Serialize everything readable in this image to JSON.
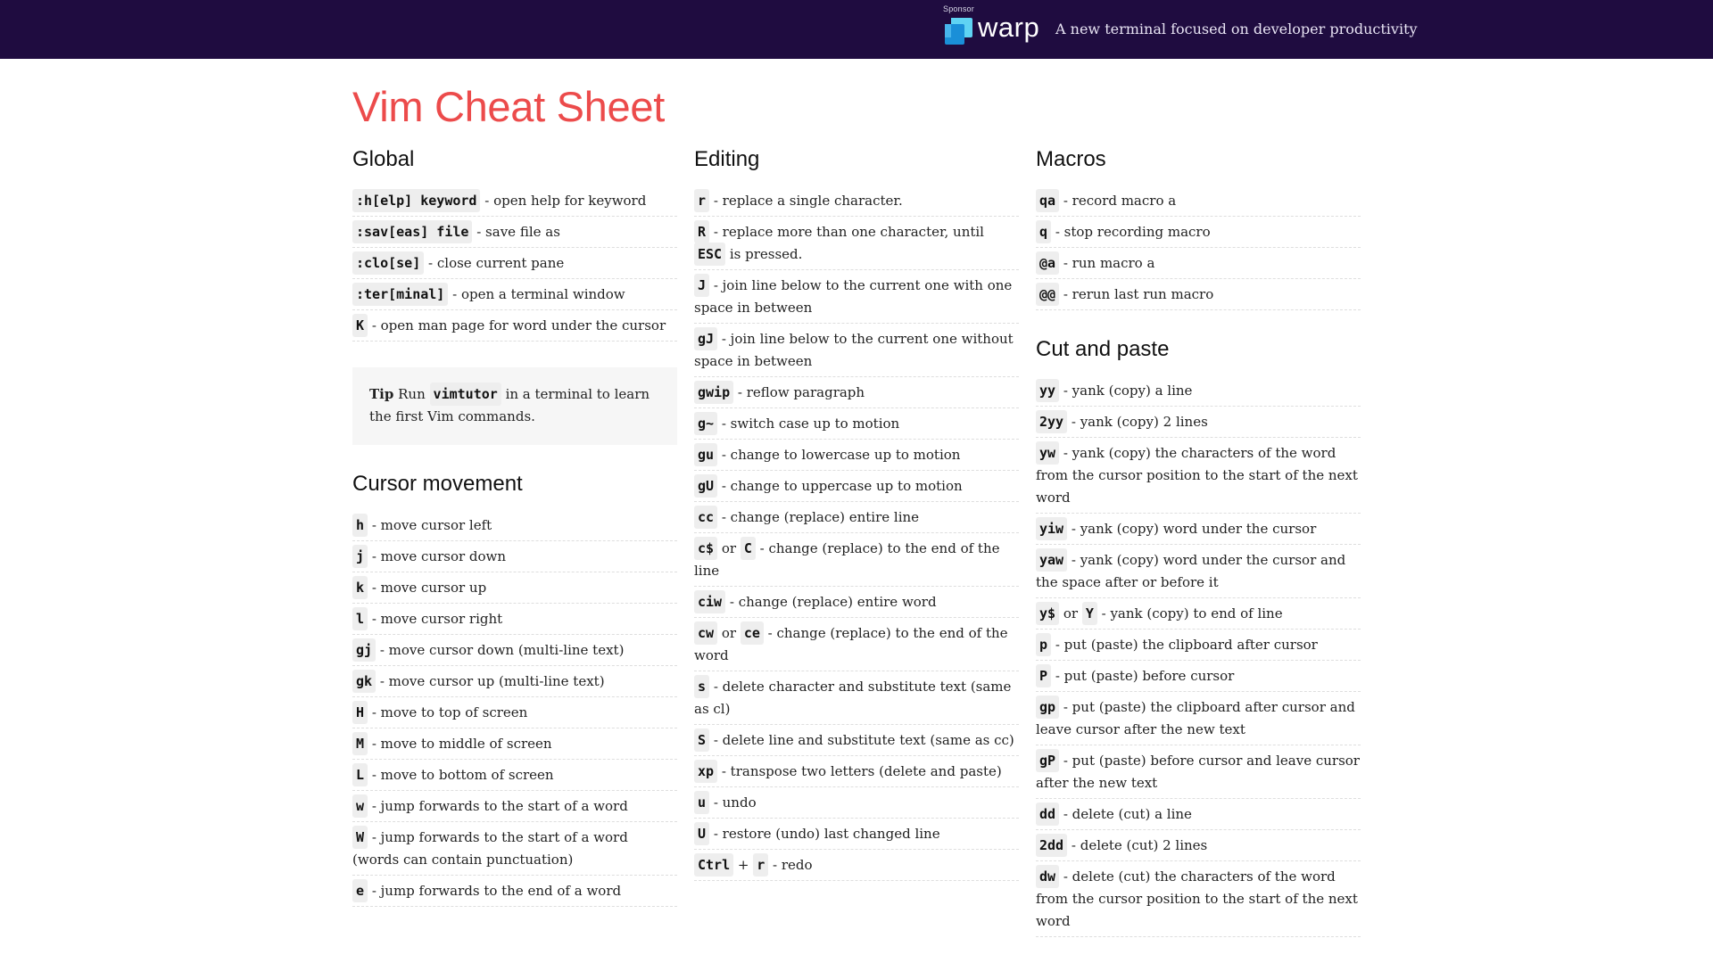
{
  "sponsor": {
    "label": "Sponsor",
    "name": "warp",
    "tagline": "A new terminal focused on developer productivity",
    "bar_color": "#1f0c40",
    "logo_colors": [
      "#5fd3f3",
      "#1a8fd8"
    ]
  },
  "title": "Vim Cheat Sheet",
  "title_color": "#ec4b4b",
  "columns": [
    {
      "sections": [
        {
          "title": "Global",
          "items": [
            {
              "keys": [
                ":h[elp] keyword"
              ],
              "desc": "- open help for keyword"
            },
            {
              "keys": [
                ":sav[eas] file"
              ],
              "desc": "- save file as"
            },
            {
              "keys": [
                ":clo[se]"
              ],
              "desc": "- close current pane"
            },
            {
              "keys": [
                ":ter[minal]"
              ],
              "desc": "- open a terminal window"
            },
            {
              "keys": [
                "K"
              ],
              "desc": "- open man page for word under the cursor"
            }
          ]
        },
        {
          "title": "Cursor movement",
          "items": [
            {
              "keys": [
                "h"
              ],
              "desc": "- move cursor left"
            },
            {
              "keys": [
                "j"
              ],
              "desc": "- move cursor down"
            },
            {
              "keys": [
                "k"
              ],
              "desc": "- move cursor up"
            },
            {
              "keys": [
                "l"
              ],
              "desc": "- move cursor right"
            },
            {
              "keys": [
                "gj"
              ],
              "desc": "- move cursor down (multi-line text)"
            },
            {
              "keys": [
                "gk"
              ],
              "desc": "- move cursor up (multi-line text)"
            },
            {
              "keys": [
                "H"
              ],
              "desc": "- move to top of screen"
            },
            {
              "keys": [
                "M"
              ],
              "desc": "- move to middle of screen"
            },
            {
              "keys": [
                "L"
              ],
              "desc": "- move to bottom of screen"
            },
            {
              "keys": [
                "w"
              ],
              "desc": "- jump forwards to the start of a word"
            },
            {
              "keys": [
                "W"
              ],
              "desc": "- jump forwards to the start of a word (words can contain punctuation)"
            },
            {
              "keys": [
                "e"
              ],
              "desc": "- jump forwards to the end of a word"
            }
          ]
        }
      ],
      "tip": {
        "label": "Tip",
        "before": "Run",
        "key": "vimtutor",
        "after": "in a terminal to learn the first Vim commands."
      }
    },
    {
      "sections": [
        {
          "title": "Editing",
          "items": [
            {
              "keys": [
                "r"
              ],
              "desc": "- replace a single character."
            },
            {
              "keys": [
                "R"
              ],
              "desc": "- replace more than one character, until",
              "key2": "ESC",
              "desc2": "is pressed."
            },
            {
              "keys": [
                "J"
              ],
              "desc": "- join line below to the current one with one space in between"
            },
            {
              "keys": [
                "gJ"
              ],
              "desc": "- join line below to the current one without space in between"
            },
            {
              "keys": [
                "gwip"
              ],
              "desc": "- reflow paragraph"
            },
            {
              "keys": [
                "g~"
              ],
              "desc": "- switch case up to motion"
            },
            {
              "keys": [
                "gu"
              ],
              "desc": "- change to lowercase up to motion"
            },
            {
              "keys": [
                "gU"
              ],
              "desc": "- change to uppercase up to motion"
            },
            {
              "keys": [
                "cc"
              ],
              "desc": "- change (replace) entire line"
            },
            {
              "keys": [
                "c$",
                "C"
              ],
              "joiner": "or",
              "desc": "- change (replace) to the end of the line"
            },
            {
              "keys": [
                "ciw"
              ],
              "desc": "- change (replace) entire word"
            },
            {
              "keys": [
                "cw",
                "ce"
              ],
              "joiner": "or",
              "desc": "- change (replace) to the end of the word"
            },
            {
              "keys": [
                "s"
              ],
              "desc": "- delete character and substitute text (same as cl)"
            },
            {
              "keys": [
                "S"
              ],
              "desc": "- delete line and substitute text (same as cc)"
            },
            {
              "keys": [
                "xp"
              ],
              "desc": "- transpose two letters (delete and paste)"
            },
            {
              "keys": [
                "u"
              ],
              "desc": "- undo"
            },
            {
              "keys": [
                "U"
              ],
              "desc": "- restore (undo) last changed line"
            },
            {
              "keys": [
                "Ctrl",
                "r"
              ],
              "joiner": "+",
              "desc": "- redo"
            }
          ]
        }
      ]
    },
    {
      "sections": [
        {
          "title": "Macros",
          "items": [
            {
              "keys": [
                "qa"
              ],
              "desc": "- record macro a"
            },
            {
              "keys": [
                "q"
              ],
              "desc": "- stop recording macro"
            },
            {
              "keys": [
                "@a"
              ],
              "desc": "- run macro a"
            },
            {
              "keys": [
                "@@"
              ],
              "desc": "- rerun last run macro"
            }
          ]
        },
        {
          "title": "Cut and paste",
          "items": [
            {
              "keys": [
                "yy"
              ],
              "desc": "- yank (copy) a line"
            },
            {
              "keys": [
                "2yy"
              ],
              "desc": "- yank (copy) 2 lines"
            },
            {
              "keys": [
                "yw"
              ],
              "desc": "- yank (copy) the characters of the word from the cursor position to the start of the next word"
            },
            {
              "keys": [
                "yiw"
              ],
              "desc": "- yank (copy) word under the cursor"
            },
            {
              "keys": [
                "yaw"
              ],
              "desc": "- yank (copy) word under the cursor and the space after or before it"
            },
            {
              "keys": [
                "y$",
                "Y"
              ],
              "joiner": "or",
              "desc": "- yank (copy) to end of line"
            },
            {
              "keys": [
                "p"
              ],
              "desc": "- put (paste) the clipboard after cursor"
            },
            {
              "keys": [
                "P"
              ],
              "desc": "- put (paste) before cursor"
            },
            {
              "keys": [
                "gp"
              ],
              "desc": "- put (paste) the clipboard after cursor and leave cursor after the new text"
            },
            {
              "keys": [
                "gP"
              ],
              "desc": "- put (paste) before cursor and leave cursor after the new text"
            },
            {
              "keys": [
                "dd"
              ],
              "desc": "- delete (cut) a line"
            },
            {
              "keys": [
                "2dd"
              ],
              "desc": "- delete (cut) 2 lines"
            },
            {
              "keys": [
                "dw"
              ],
              "desc": "- delete (cut) the characters of the word from the cursor position to the start of the next word"
            }
          ]
        }
      ]
    }
  ]
}
